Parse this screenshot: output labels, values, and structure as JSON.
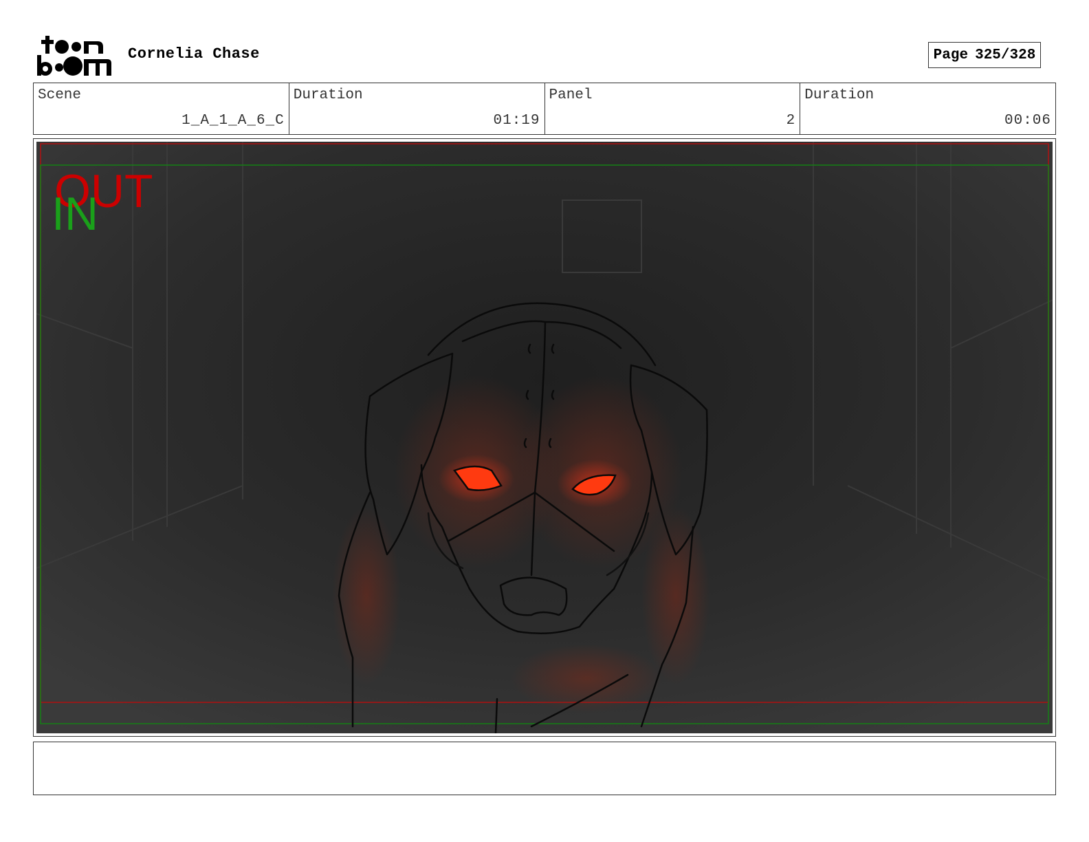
{
  "header": {
    "logo_text": "toon boom",
    "project_title": "Cornelia Chase",
    "page_label": "Page",
    "page_number": "325/328"
  },
  "info": {
    "scene_label": "Scene",
    "scene_value": "1_A_1_A_6_C",
    "scene_duration_label": "Duration",
    "scene_duration_value": "01:19",
    "panel_label": "Panel",
    "panel_value": "2",
    "panel_duration_label": "Duration",
    "panel_duration_value": "00:06"
  },
  "panel": {
    "out_label": "OUT",
    "in_label": "IN",
    "out_color": "#cc0000",
    "in_color": "#1aa01a",
    "eye_color": "#ff3a10"
  },
  "notes": {
    "text": ""
  }
}
